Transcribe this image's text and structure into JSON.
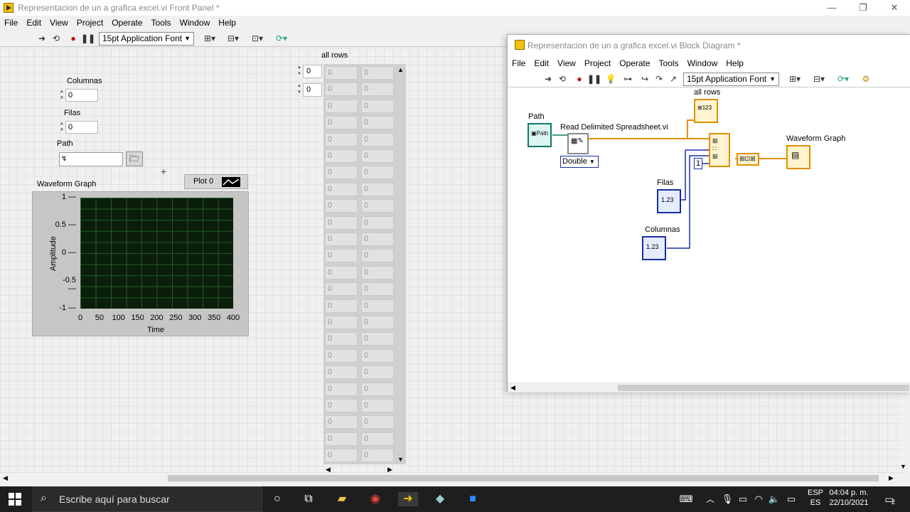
{
  "front_panel": {
    "title": "Representacion de un a grafica excel.vi Front Panel *",
    "menu": [
      "File",
      "Edit",
      "View",
      "Project",
      "Operate",
      "Tools",
      "Window",
      "Help"
    ],
    "font_selector": "15pt Application Font",
    "controls": {
      "columnas_label": "Columnas",
      "columnas_value": "0",
      "filas_label": "Filas",
      "filas_value": "0",
      "path_label": "Path",
      "path_value": ""
    },
    "graph": {
      "title": "Waveform Graph",
      "legend": "Plot 0",
      "ylabel": "Amplitude",
      "xlabel": "Time",
      "yticks": [
        "1",
        "0.5",
        "0",
        "-0.5",
        "-1"
      ],
      "xticks": [
        "0",
        "50",
        "100",
        "150",
        "200",
        "250",
        "300",
        "350",
        "400"
      ]
    },
    "array": {
      "label": "all rows",
      "index_row": "0",
      "index_col": "0",
      "cell_value": "0"
    }
  },
  "block_diagram": {
    "title": "Representacion de un a grafica excel.vi Block Diagram *",
    "menu": [
      "File",
      "Edit",
      "View",
      "Project",
      "Operate",
      "Tools",
      "Window",
      "Help"
    ],
    "font_selector": "15pt Application Font",
    "labels": {
      "path": "Path",
      "read_vi": "Read Delimited Spreadsheet.vi",
      "double": "Double",
      "all_rows": "all rows",
      "filas": "Filas",
      "columnas": "Columnas",
      "waveform_graph": "Waveform Graph",
      "const_one": "1"
    }
  },
  "chart_data": {
    "type": "line",
    "title": "Waveform Graph",
    "xlabel": "Time",
    "ylabel": "Amplitude",
    "xlim": [
      0,
      400
    ],
    "ylim": [
      -1,
      1
    ],
    "series": [
      {
        "name": "Plot 0",
        "values": []
      }
    ],
    "grid": true,
    "legend": "top-right"
  },
  "taskbar": {
    "search_placeholder": "Escribe aquí para buscar",
    "lang_top": "ESP",
    "lang_bottom": "ES",
    "time": "04:04 p. m.",
    "date": "22/10/2021",
    "notif_count": "2"
  },
  "colors": {
    "plot_bg": "#0b1d0b",
    "grid": "#1f5e22",
    "wire_orange": "#e08f00",
    "wire_blue": "#1a2ca8",
    "taskbar": "#1e1e1e"
  }
}
